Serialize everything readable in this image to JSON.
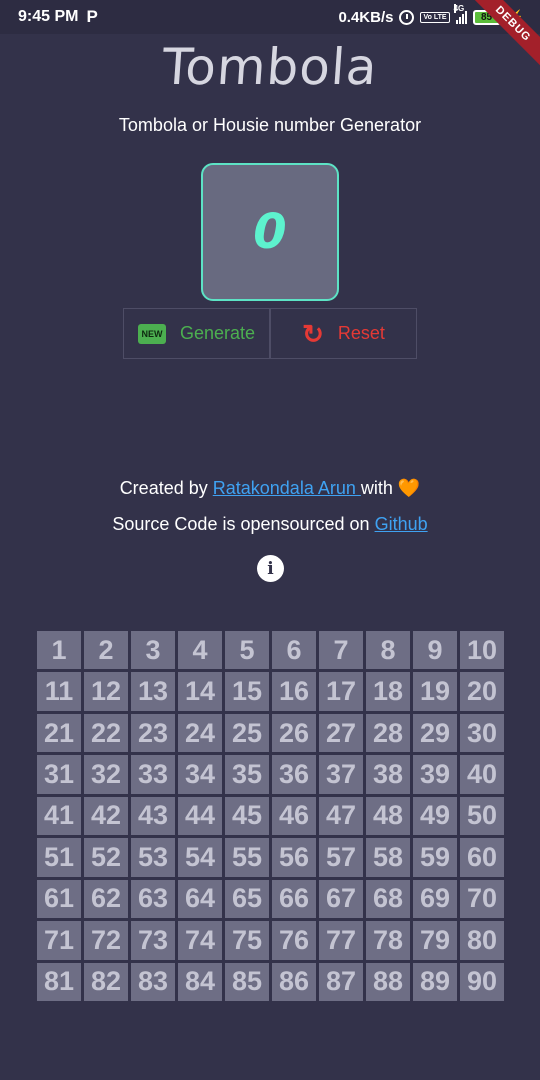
{
  "status_bar": {
    "time": "9:45 PM",
    "p_icon_text": "P",
    "speed": "0.4KB/s",
    "network_tag": "4G",
    "volte_text": "Vo LTE",
    "battery": "85"
  },
  "debug_banner": "DEBUG",
  "header": {
    "title": "Tombola",
    "subtitle": "Tombola or Housie number Generator"
  },
  "current_number": "0",
  "buttons": {
    "generate_label": "Generate",
    "generate_icon": "NEW",
    "reset_label": "Reset"
  },
  "credits": {
    "created_prefix": "Created by ",
    "author": "Ratakondala Arun ",
    "with_text": "with ",
    "heart": "🧡",
    "source_prefix": "Source Code is opensourced on ",
    "github": "Github"
  },
  "info_icon_glyph": "i",
  "board": {
    "numbers": [
      1,
      2,
      3,
      4,
      5,
      6,
      7,
      8,
      9,
      10,
      11,
      12,
      13,
      14,
      15,
      16,
      17,
      18,
      19,
      20,
      21,
      22,
      23,
      24,
      25,
      26,
      27,
      28,
      29,
      30,
      31,
      32,
      33,
      34,
      35,
      36,
      37,
      38,
      39,
      40,
      41,
      42,
      43,
      44,
      45,
      46,
      47,
      48,
      49,
      50,
      51,
      52,
      53,
      54,
      55,
      56,
      57,
      58,
      59,
      60,
      61,
      62,
      63,
      64,
      65,
      66,
      67,
      68,
      69,
      70,
      71,
      72,
      73,
      74,
      75,
      76,
      77,
      78,
      79,
      80,
      81,
      82,
      83,
      84,
      85,
      86,
      87,
      88,
      89,
      90
    ]
  },
  "colors": {
    "background": "#33324a",
    "accent": "#5df2ce",
    "generate": "#4caf50",
    "reset": "#e53935",
    "link": "#3fa2f2"
  }
}
